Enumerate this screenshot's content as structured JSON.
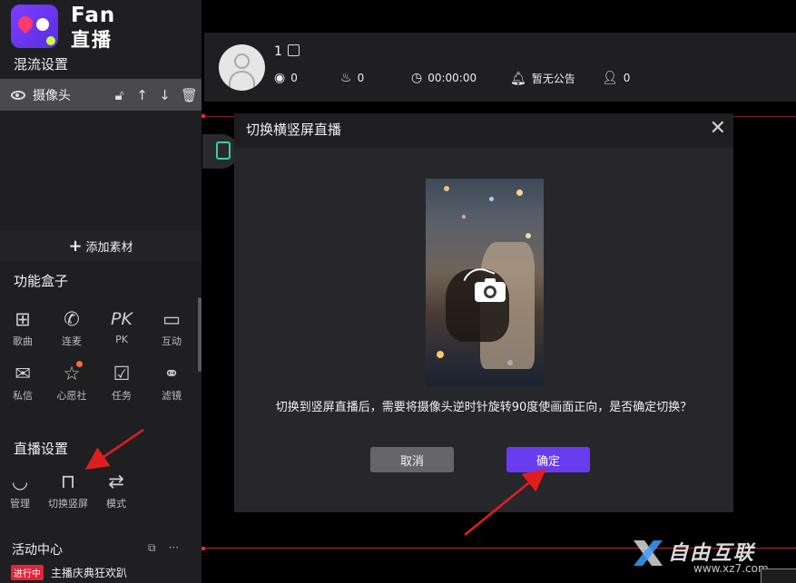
{
  "brand": {
    "name_en": "Fan",
    "name_cn": "直播"
  },
  "mix": {
    "title": "混流设置",
    "source_label": "摄像头",
    "tools": [
      "lock-icon",
      "arrow-up-icon",
      "arrow-down-icon",
      "trash-icon"
    ]
  },
  "add_material": {
    "label": "添加素材"
  },
  "function_box": {
    "title": "功能盒子",
    "items": [
      {
        "label": "歌曲",
        "icon": "grid-icon"
      },
      {
        "label": "连麦",
        "icon": "phone-icon"
      },
      {
        "label": "PK",
        "icon": "pk-icon",
        "icon_text": "PK"
      },
      {
        "label": "互动",
        "icon": "chat-icon"
      },
      {
        "label": "私信",
        "icon": "mail-icon"
      },
      {
        "label": "心愿社",
        "icon": "wish-icon"
      },
      {
        "label": "任务",
        "icon": "task-icon"
      },
      {
        "label": "滤镜",
        "icon": "filter-icon"
      }
    ]
  },
  "live_settings": {
    "title": "直播设置",
    "items": [
      {
        "label": "管理",
        "icon": "manage-icon"
      },
      {
        "label": "切换竖屏",
        "icon": "rotate-screen-icon"
      },
      {
        "label": "模式",
        "icon": "mode-icon"
      }
    ]
  },
  "activity": {
    "title": "活动中心",
    "badge": "进行中",
    "item": "主播庆典狂欢趴"
  },
  "topbar": {
    "username": "1",
    "stats": [
      {
        "icon": "coin-icon",
        "value": "0"
      },
      {
        "icon": "fire-icon",
        "value": "0"
      },
      {
        "icon": "clock-icon",
        "value": "00:00:00"
      },
      {
        "icon": "bell-icon",
        "value": "暂无公告"
      },
      {
        "icon": "user-icon",
        "value": "0"
      }
    ]
  },
  "modal": {
    "title": "切换横竖屏直播",
    "message": "切换到竖屏直播后，需要将摄像头逆时针旋转90度使画面正向，是否确定切换？",
    "cancel_label": "取消",
    "confirm_label": "确定"
  },
  "watermark": {
    "text": "自由互联",
    "url": "www.xz7.com"
  },
  "colors": {
    "accent": "#6a3cf0",
    "annotation": "#e01e1e",
    "highlight": "#35d39a"
  }
}
